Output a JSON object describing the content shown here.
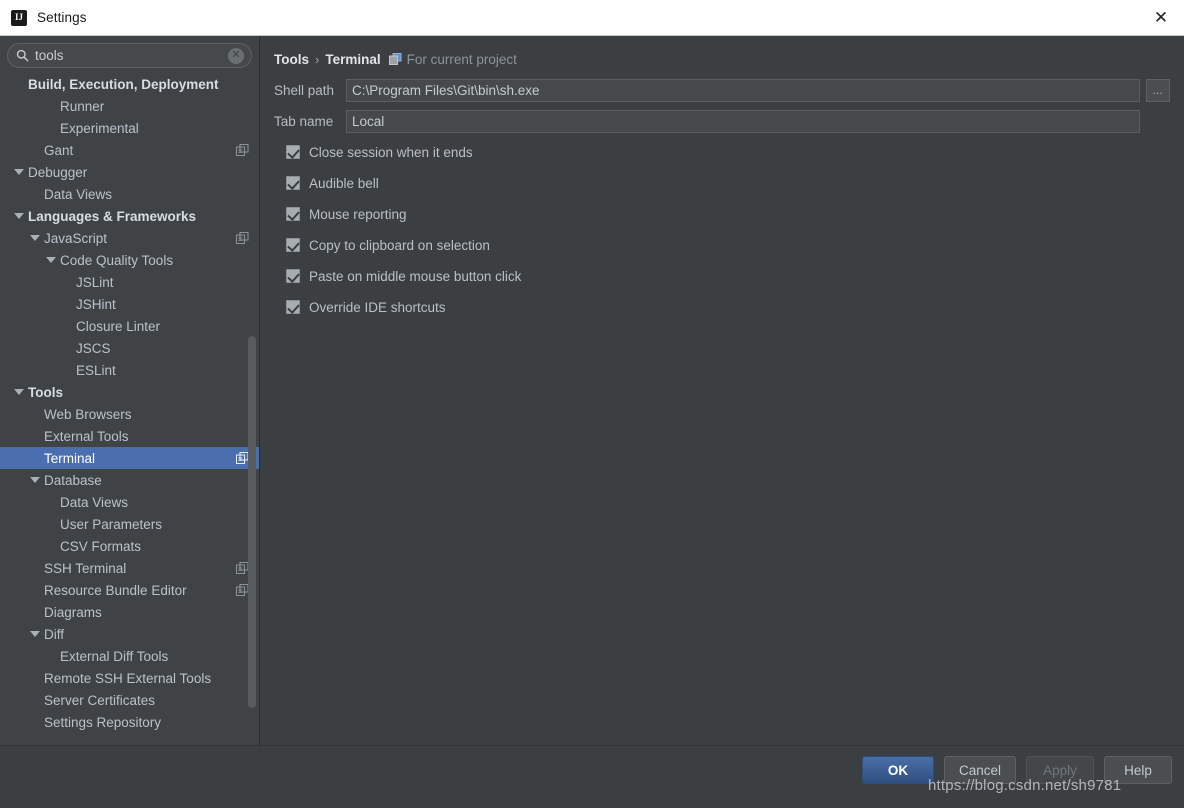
{
  "window": {
    "title": "Settings",
    "logo_text": "IJ",
    "close_icon": "✕"
  },
  "search": {
    "value": "tools",
    "placeholder": "Search settings",
    "icon": "search-icon",
    "clear_icon": "✕"
  },
  "sidebar": {
    "items": [
      {
        "label": "Build, Execution, Deployment",
        "indent": 0,
        "group": true,
        "twisty": "",
        "scope_icon": false,
        "selected": false
      },
      {
        "label": "Runner",
        "indent": 2,
        "group": false,
        "twisty": "",
        "scope_icon": false,
        "selected": false
      },
      {
        "label": "Experimental",
        "indent": 2,
        "group": false,
        "twisty": "",
        "scope_icon": false,
        "selected": false
      },
      {
        "label": "Gant",
        "indent": 1,
        "group": false,
        "twisty": "",
        "scope_icon": true,
        "selected": false
      },
      {
        "label": "Debugger",
        "indent": 0,
        "group": false,
        "twisty": "open",
        "scope_icon": false,
        "selected": false
      },
      {
        "label": "Data Views",
        "indent": 1,
        "group": false,
        "twisty": "",
        "scope_icon": false,
        "selected": false
      },
      {
        "label": "Languages & Frameworks",
        "indent": 0,
        "group": true,
        "twisty": "open",
        "scope_icon": false,
        "selected": false
      },
      {
        "label": "JavaScript",
        "indent": 1,
        "group": false,
        "twisty": "open",
        "scope_icon": true,
        "selected": false
      },
      {
        "label": "Code Quality Tools",
        "indent": 2,
        "group": false,
        "twisty": "open",
        "scope_icon": false,
        "selected": false
      },
      {
        "label": "JSLint",
        "indent": 3,
        "group": false,
        "twisty": "",
        "scope_icon": false,
        "selected": false
      },
      {
        "label": "JSHint",
        "indent": 3,
        "group": false,
        "twisty": "",
        "scope_icon": false,
        "selected": false
      },
      {
        "label": "Closure Linter",
        "indent": 3,
        "group": false,
        "twisty": "",
        "scope_icon": false,
        "selected": false
      },
      {
        "label": "JSCS",
        "indent": 3,
        "group": false,
        "twisty": "",
        "scope_icon": false,
        "selected": false
      },
      {
        "label": "ESLint",
        "indent": 3,
        "group": false,
        "twisty": "",
        "scope_icon": false,
        "selected": false
      },
      {
        "label": "Tools",
        "indent": 0,
        "group": true,
        "twisty": "open",
        "scope_icon": false,
        "selected": false
      },
      {
        "label": "Web Browsers",
        "indent": 1,
        "group": false,
        "twisty": "",
        "scope_icon": false,
        "selected": false
      },
      {
        "label": "External Tools",
        "indent": 1,
        "group": false,
        "twisty": "",
        "scope_icon": false,
        "selected": false
      },
      {
        "label": "Terminal",
        "indent": 1,
        "group": false,
        "twisty": "",
        "scope_icon": true,
        "selected": true
      },
      {
        "label": "Database",
        "indent": 1,
        "group": false,
        "twisty": "open",
        "scope_icon": false,
        "selected": false
      },
      {
        "label": "Data Views",
        "indent": 2,
        "group": false,
        "twisty": "",
        "scope_icon": false,
        "selected": false
      },
      {
        "label": "User Parameters",
        "indent": 2,
        "group": false,
        "twisty": "",
        "scope_icon": false,
        "selected": false
      },
      {
        "label": "CSV Formats",
        "indent": 2,
        "group": false,
        "twisty": "",
        "scope_icon": false,
        "selected": false
      },
      {
        "label": "SSH Terminal",
        "indent": 1,
        "group": false,
        "twisty": "",
        "scope_icon": true,
        "selected": false
      },
      {
        "label": "Resource Bundle Editor",
        "indent": 1,
        "group": false,
        "twisty": "",
        "scope_icon": true,
        "selected": false
      },
      {
        "label": "Diagrams",
        "indent": 1,
        "group": false,
        "twisty": "",
        "scope_icon": false,
        "selected": false
      },
      {
        "label": "Diff",
        "indent": 1,
        "group": false,
        "twisty": "open",
        "scope_icon": false,
        "selected": false
      },
      {
        "label": "External Diff Tools",
        "indent": 2,
        "group": false,
        "twisty": "",
        "scope_icon": false,
        "selected": false
      },
      {
        "label": "Remote SSH External Tools",
        "indent": 1,
        "group": false,
        "twisty": "",
        "scope_icon": false,
        "selected": false
      },
      {
        "label": "Server Certificates",
        "indent": 1,
        "group": false,
        "twisty": "",
        "scope_icon": false,
        "selected": false
      },
      {
        "label": "Settings Repository",
        "indent": 1,
        "group": false,
        "twisty": "",
        "scope_icon": false,
        "selected": false
      }
    ],
    "selected_color": "#4b6eaf"
  },
  "panel": {
    "breadcrumb": {
      "parent": "Tools",
      "separator": "›",
      "current": "Terminal"
    },
    "scope_label": "For current project",
    "scope_icon": "project-scope-icon",
    "fields": [
      {
        "label": "Shell path",
        "value": "C:\\Program Files\\Git\\bin\\sh.exe",
        "placeholder": "Shell path"
      },
      {
        "label": "Tab name",
        "value": "Local",
        "placeholder": "Tab name"
      }
    ],
    "browse_label": "…",
    "checkboxes": [
      {
        "label": "Close session when it ends",
        "checked": true
      },
      {
        "label": "Audible bell",
        "checked": true
      },
      {
        "label": "Mouse reporting",
        "checked": true
      },
      {
        "label": "Copy to clipboard on selection",
        "checked": true
      },
      {
        "label": "Paste on middle mouse button click",
        "checked": true
      },
      {
        "label": "Override IDE shortcuts",
        "checked": true
      }
    ]
  },
  "footer": {
    "buttons": [
      {
        "label": "OK",
        "style": "default"
      },
      {
        "label": "Cancel",
        "style": "normal"
      },
      {
        "label": "Apply",
        "style": "disabled"
      },
      {
        "label": "Help",
        "style": "normal"
      }
    ]
  },
  "watermark": {
    "text": "https://blog.csdn.net/sh9781"
  }
}
